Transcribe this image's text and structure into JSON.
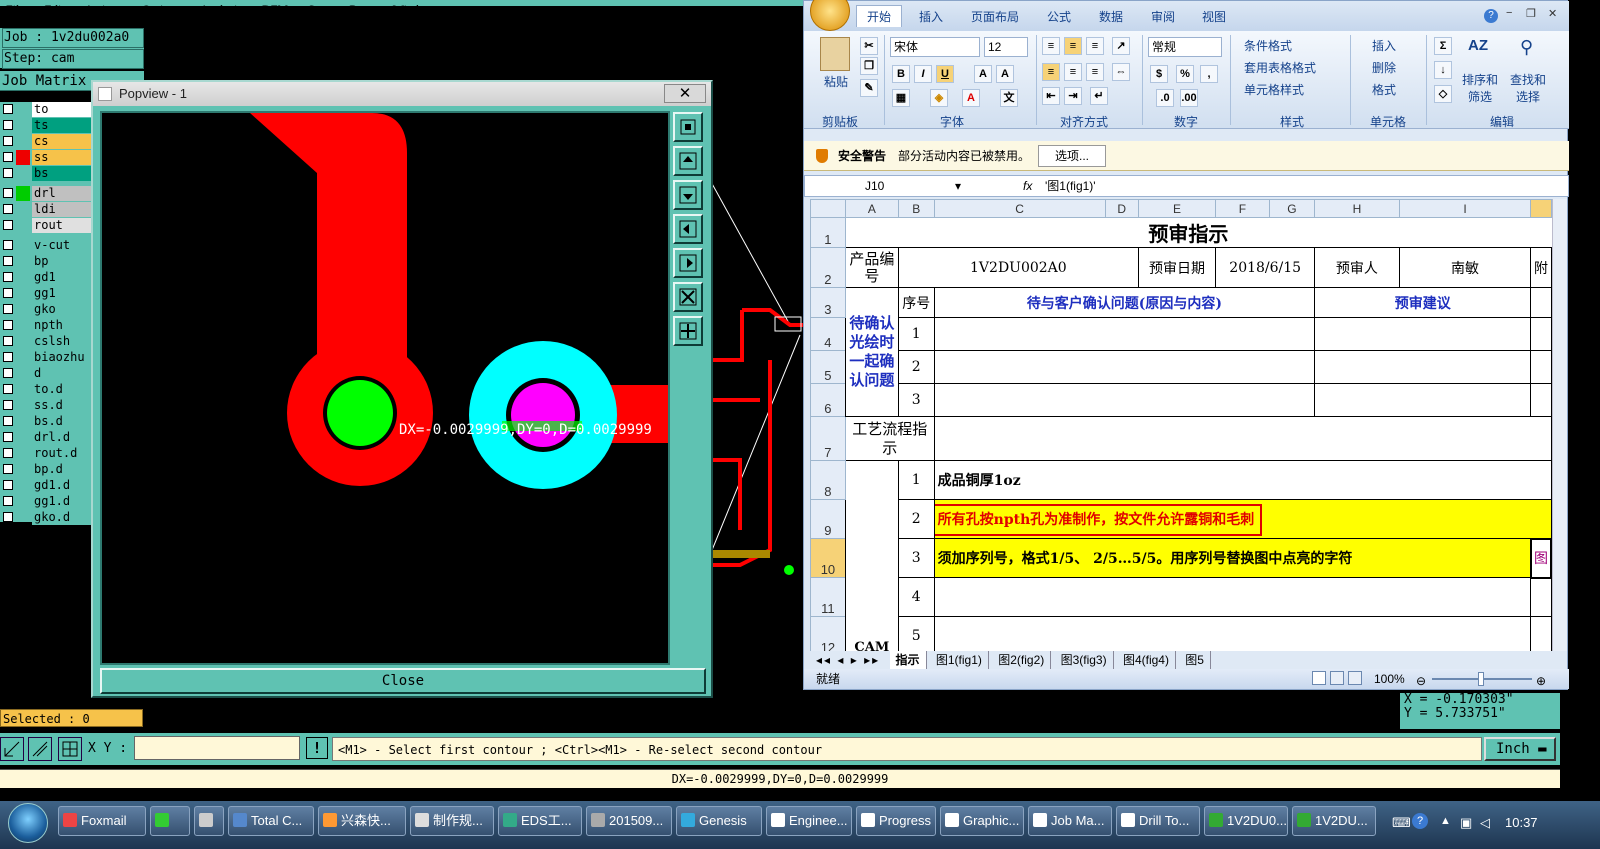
{
  "cam": {
    "menu": [
      "File",
      "Edit",
      "Actions",
      "Options",
      "Analysis",
      "DFM",
      "Step",
      "Rout",
      "Windows"
    ],
    "job_label": "Job : 1v2du002a0",
    "step_label": "Step: cam",
    "matrix_label": "Job Matrix",
    "layers": [
      {
        "name": "to",
        "color": "#ffffff"
      },
      {
        "name": "ts",
        "color": "#00a080"
      },
      {
        "name": "cs",
        "color": "#f6c24a"
      },
      {
        "name": "ss",
        "color": "#f6c24a"
      },
      {
        "name": "bs",
        "color": "#00a080"
      },
      {
        "name": "drl",
        "color": "#c0c0c0"
      },
      {
        "name": "ldi",
        "color": "#c0c0c0"
      },
      {
        "name": "rout",
        "color": "#e0e0e0"
      },
      {
        "name": "v-cut",
        "color": "#5fc2b2"
      },
      {
        "name": "bp",
        "color": "#5fc2b2"
      },
      {
        "name": "gd1",
        "color": "#5fc2b2"
      },
      {
        "name": "gg1",
        "color": "#5fc2b2"
      },
      {
        "name": "gko",
        "color": "#5fc2b2"
      },
      {
        "name": "npth",
        "color": "#5fc2b2"
      },
      {
        "name": "cslsh",
        "color": "#5fc2b2"
      },
      {
        "name": "biaozhu",
        "color": "#5fc2b2"
      },
      {
        "name": "d",
        "color": "#5fc2b2"
      },
      {
        "name": "to.d",
        "color": "#5fc2b2"
      },
      {
        "name": "ss.d",
        "color": "#5fc2b2"
      },
      {
        "name": "bs.d",
        "color": "#5fc2b2"
      },
      {
        "name": "drl.d",
        "color": "#5fc2b2"
      },
      {
        "name": "rout.d",
        "color": "#5fc2b2"
      },
      {
        "name": "bp.d",
        "color": "#5fc2b2"
      },
      {
        "name": "gd1.d",
        "color": "#5fc2b2"
      },
      {
        "name": "gg1.d",
        "color": "#5fc2b2"
      },
      {
        "name": "gko.d",
        "color": "#5fc2b2"
      }
    ],
    "selected_label": "Selected : 0",
    "xy_label": "X Y :",
    "xy_value": "",
    "prompt": "<M1> - Select first contour ; <Ctrl><M1> - Re-select second contour",
    "unit": "Inch",
    "status": "DX=-0.0029999,DY=0,D=0.0029999",
    "coord_x": "X = -0.170303\"",
    "coord_y": "Y = 5.733751\""
  },
  "popview": {
    "title": "Popview - 1",
    "close_x": "✕",
    "close_button": "Close",
    "measure_text": "DX=-0.0029999,DY=0,D=0.0029999"
  },
  "excel": {
    "tabs": [
      "开始",
      "插入",
      "页面布局",
      "公式",
      "数据",
      "审阅",
      "视图"
    ],
    "font_name": "宋体",
    "font_size": "12",
    "number_format": "常规",
    "groups": [
      "剪贴板",
      "字体",
      "对齐方式",
      "数字",
      "样式",
      "单元格",
      "编辑"
    ],
    "paste": "粘贴",
    "style_items": [
      "条件格式",
      "套用表格格式",
      "单元格样式"
    ],
    "cell_items": [
      "插入",
      "删除",
      "格式"
    ],
    "edit_items": [
      "排序和筛选",
      "查找和选择"
    ],
    "security_title": "安全警告",
    "security_msg": "部分活动内容已被禁用。",
    "security_btn": "选项...",
    "name_box": "J10",
    "formula": "'图1(fig1)'",
    "col_headers": [
      "A",
      "B",
      "C",
      "D",
      "E",
      "F",
      "G",
      "H",
      "I"
    ],
    "sheet": {
      "title": "预审指示",
      "product_no_label": "产品编号",
      "product_no": "1V2DU002A0",
      "review_date_label": "预审日期",
      "review_date": "2018/6/15",
      "reviewer_label": "预审人",
      "reviewer": "南敏",
      "attach_label": "附",
      "confirm_label": "待确认光绘时一起确认问题",
      "seq_label": "序号",
      "issue_header": "待与客户确认问题(原因与内容)",
      "suggest_header": "预审建议",
      "flow_label": "工艺流程指示",
      "cam_label": "CAM",
      "notes": [
        "成品铜厚1oz",
        "所有孔按npth孔为准制作，按文件允许露铜和毛刺",
        "须加序列号，格式1/5、 2/5…5/5。用序列号替换图中点亮的字符"
      ],
      "fig_ref": "图"
    },
    "sheet_tabs": [
      "指示",
      "图1(fig1)",
      "图2(fig2)",
      "图3(fig3)",
      "图4(fig4)",
      "图5"
    ],
    "status_ready": "就绪",
    "zoom": "100%"
  },
  "taskbar": {
    "items": [
      "Foxmail",
      "",
      "",
      "Total C...",
      "兴森快...",
      "制作规...",
      "EDS工...",
      "201509...",
      "Genesis",
      "Enginee...",
      "Progress",
      "Graphic...",
      "Job Ma...",
      "Drill To...",
      "1V2DU0...",
      "1V2DU..."
    ],
    "clock": "10:37"
  }
}
